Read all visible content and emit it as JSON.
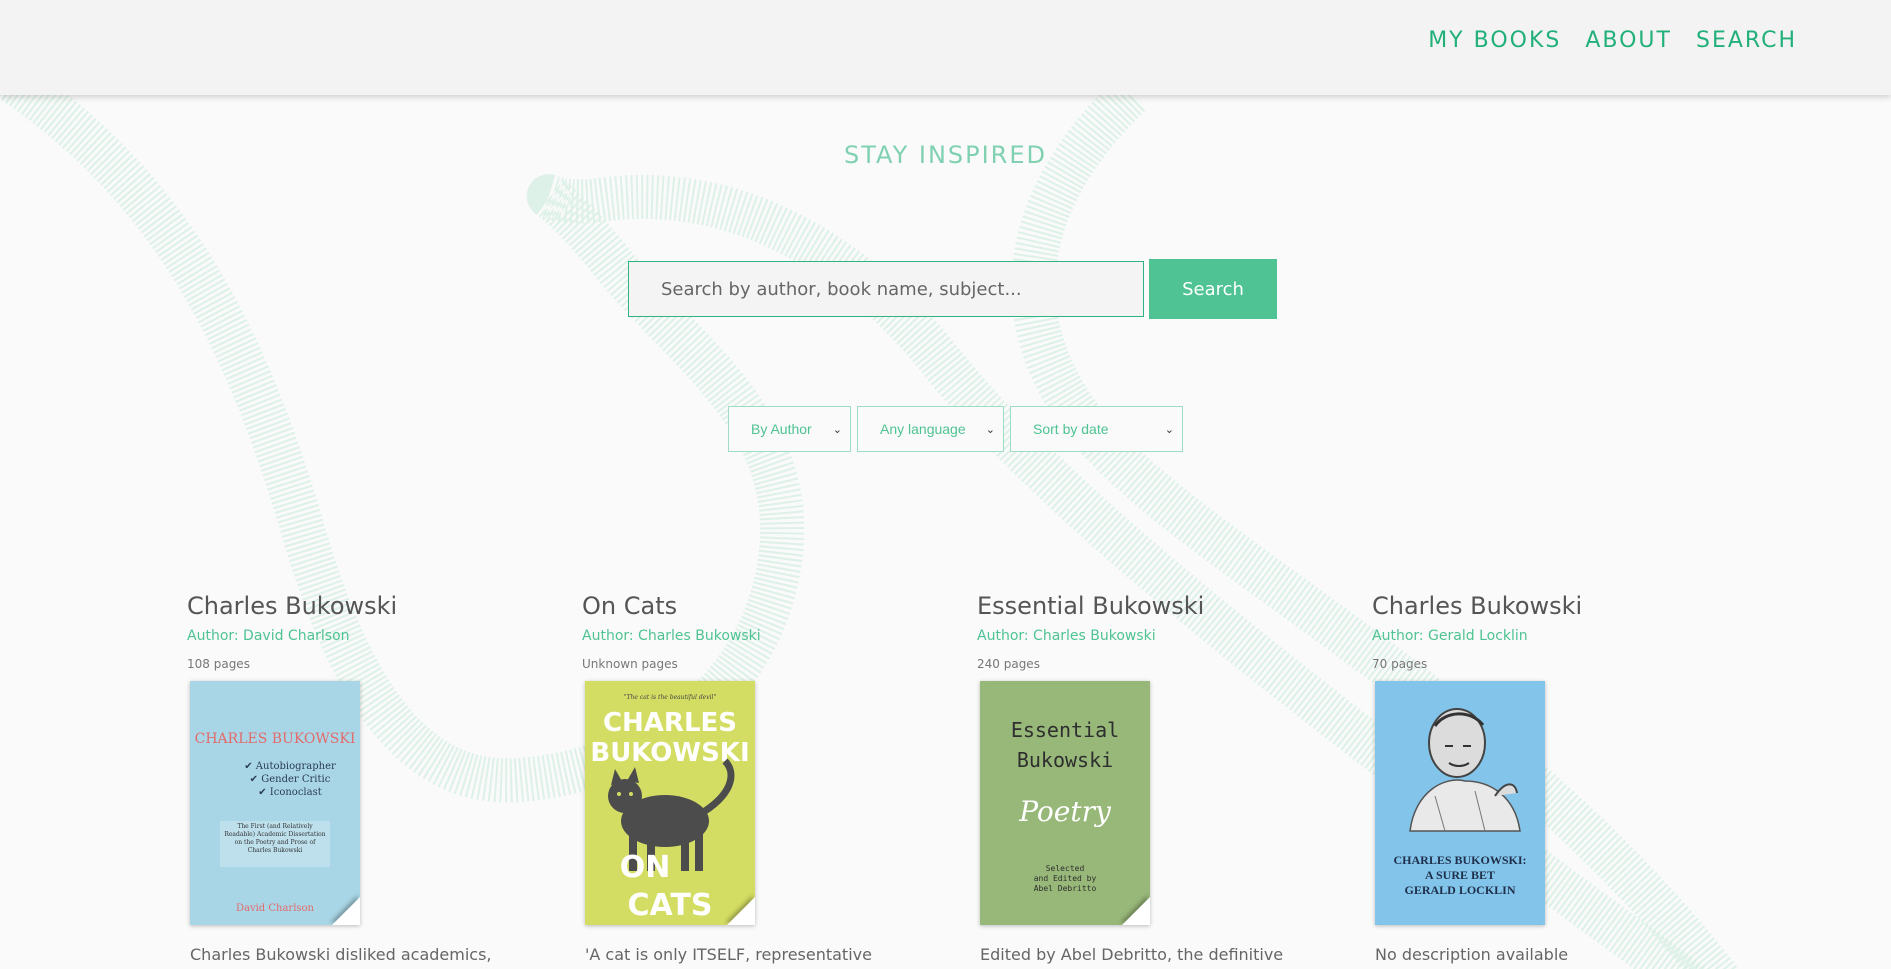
{
  "nav": {
    "items": [
      {
        "label": "MY BOOKS"
      },
      {
        "label": "ABOUT"
      },
      {
        "label": "SEARCH"
      }
    ]
  },
  "hero": {
    "tagline": "STAY INSPIRED"
  },
  "search": {
    "placeholder": "Search by author, book name, subject...",
    "value": "",
    "button_label": "Search"
  },
  "filters": {
    "type": "By Author",
    "language": "Any language",
    "sort": "Sort by date"
  },
  "books": [
    {
      "title": "Charles Bukowski",
      "author": "Author: David Charlson",
      "pages": "108 pages",
      "cover": {
        "bg": "#a9d6e6",
        "heading": "CHARLES BUKOWSKI",
        "checklist": [
          "✔ Autobiographer",
          "✔ Gender Critic",
          "✔ Iconoclast"
        ],
        "subtitle": "The First (and Relatively Readable) Academic Dissertation on the Poetry and Prose of Charles Bukowski",
        "footer": "David Charlson"
      },
      "description": "Charles Bukowski disliked academics,"
    },
    {
      "title": "On Cats",
      "author": "Author: Charles Bukowski",
      "pages": "Unknown pages",
      "cover": {
        "bg": "#d4dd63",
        "quote": "\"The cat is the beautiful devil\"",
        "heading_line1": "CHARLES",
        "heading_line2": "BUKOWSKI",
        "footer_line1": "ON",
        "footer_line2": "CATS"
      },
      "description": "'A cat is only ITSELF, representative"
    },
    {
      "title": "Essential Bukowski",
      "author": "Author: Charles Bukowski",
      "pages": "240 pages",
      "cover": {
        "bg": "#98b87a",
        "heading_line1": "Essential",
        "heading_line2": "Bukowski",
        "script": "Poetry",
        "credit_line1": "Selected",
        "credit_line2": "and Edited by",
        "credit_line3": "Abel Debritto"
      },
      "description": "Edited by Abel Debritto, the definitive"
    },
    {
      "title": "Charles Bukowski",
      "author": "Author: Gerald Locklin",
      "pages": "70 pages",
      "cover": {
        "bg": "#82c4ea",
        "caption_line1": "CHARLES BUKOWSKI:",
        "caption_line2": "A SURE BET",
        "caption_line3": "GERALD LOCKLIN"
      },
      "description": "No description available"
    }
  ],
  "colors": {
    "accent": "#4fc393",
    "nav_text": "#22b07a",
    "tagline": "#7fd1b2",
    "background": "#f9faf9",
    "header_bg": "#f3f3f3"
  }
}
